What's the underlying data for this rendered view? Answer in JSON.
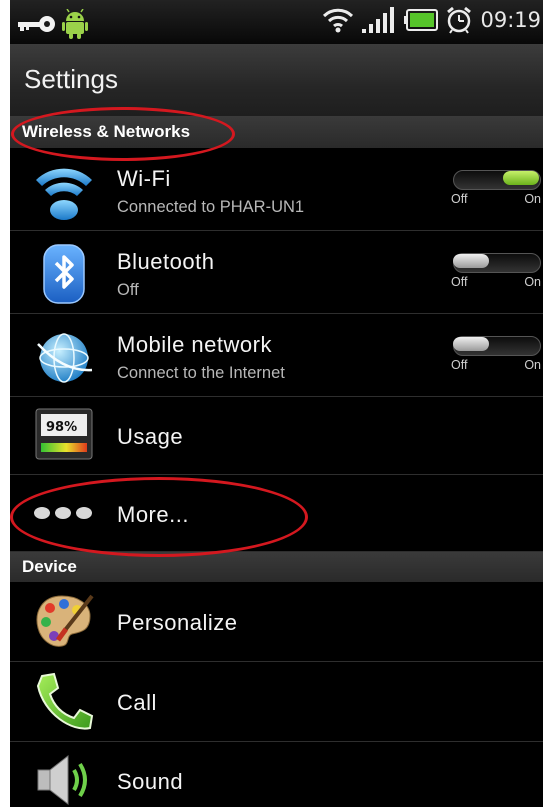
{
  "status_bar": {
    "time": "09:19"
  },
  "title": "Settings",
  "sections": {
    "wireless": "Wireless & Networks",
    "device": "Device"
  },
  "rows": {
    "wifi": {
      "label": "Wi-Fi",
      "sub": "Connected to PHAR-UN1",
      "toggle_on": true
    },
    "bluetooth": {
      "label": "Bluetooth",
      "sub": "Off",
      "toggle_on": false
    },
    "mobile": {
      "label": "Mobile network",
      "sub": "Connect to the Internet",
      "toggle_on": false
    },
    "usage": {
      "label": "Usage",
      "icon_text": "98%"
    },
    "more": {
      "label": "More..."
    },
    "personalize": {
      "label": "Personalize"
    },
    "call": {
      "label": "Call"
    },
    "sound": {
      "label": "Sound"
    }
  },
  "toggle_labels": {
    "off": "Off",
    "on": "On"
  },
  "colors": {
    "annotation": "#d4181f",
    "toggle_on": "#8fd33a"
  }
}
